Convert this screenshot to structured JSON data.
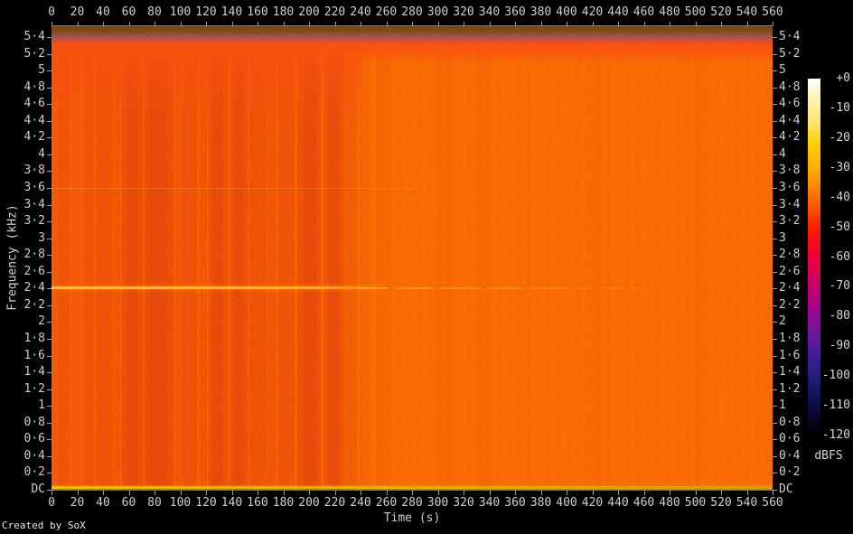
{
  "meta": {
    "credit": "Created by SoX"
  },
  "chart_data": {
    "type": "heatmap",
    "subtype": "audio-spectrogram",
    "title": "",
    "xlabel": "Time (s)",
    "ylabel": "Frequency (kHz)",
    "x_range": [
      0,
      560
    ],
    "x_ticks": [
      0,
      20,
      40,
      60,
      80,
      100,
      120,
      140,
      160,
      180,
      200,
      220,
      240,
      260,
      280,
      300,
      320,
      340,
      360,
      380,
      400,
      420,
      440,
      460,
      480,
      500,
      520,
      540,
      560
    ],
    "y_range_khz": [
      0,
      5.53
    ],
    "y_ticks": [
      {
        "v": 0,
        "l": "DC"
      },
      {
        "v": 0.2,
        "l": "0·2"
      },
      {
        "v": 0.4,
        "l": "0·4"
      },
      {
        "v": 0.6,
        "l": "0·6"
      },
      {
        "v": 0.8,
        "l": "0·8"
      },
      {
        "v": 1,
        "l": "1"
      },
      {
        "v": 1.2,
        "l": "1·2"
      },
      {
        "v": 1.4,
        "l": "1·4"
      },
      {
        "v": 1.6,
        "l": "1·6"
      },
      {
        "v": 1.8,
        "l": "1·8"
      },
      {
        "v": 2,
        "l": "2"
      },
      {
        "v": 2.2,
        "l": "2·2"
      },
      {
        "v": 2.4,
        "l": "2·4"
      },
      {
        "v": 2.6,
        "l": "2·6"
      },
      {
        "v": 2.8,
        "l": "2·8"
      },
      {
        "v": 3,
        "l": "3"
      },
      {
        "v": 3.2,
        "l": "3·2"
      },
      {
        "v": 3.4,
        "l": "3·4"
      },
      {
        "v": 3.6,
        "l": "3·6"
      },
      {
        "v": 3.8,
        "l": "3·8"
      },
      {
        "v": 4,
        "l": "4"
      },
      {
        "v": 4.2,
        "l": "4·2"
      },
      {
        "v": 4.4,
        "l": "4·4"
      },
      {
        "v": 4.6,
        "l": "4·6"
      },
      {
        "v": 4.8,
        "l": "4·8"
      },
      {
        "v": 5,
        "l": "5"
      },
      {
        "v": 5.2,
        "l": "5·2"
      },
      {
        "v": 5.4,
        "l": "5·4"
      }
    ],
    "colorbar": {
      "label": "dBFS",
      "ticks": [
        "+0",
        "-10",
        "-20",
        "-30",
        "-40",
        "-50",
        "-60",
        "-70",
        "-80",
        "-90",
        "-100",
        "-110",
        "-120"
      ],
      "range_db": [
        0,
        -120
      ],
      "stops": [
        {
          "c": "#ffffff",
          "p": 0
        },
        {
          "c": "#fff8d2",
          "p": 3
        },
        {
          "c": "#ffef9c",
          "p": 8
        },
        {
          "c": "#ffe35e",
          "p": 13
        },
        {
          "c": "#ffd100",
          "p": 18
        },
        {
          "c": "#ffb300",
          "p": 24
        },
        {
          "c": "#ff8a00",
          "p": 30
        },
        {
          "c": "#ff5500",
          "p": 36
        },
        {
          "c": "#ff1c00",
          "p": 42
        },
        {
          "c": "#f00032",
          "p": 49
        },
        {
          "c": "#d00060",
          "p": 56
        },
        {
          "c": "#a8008a",
          "p": 63
        },
        {
          "c": "#7c129a",
          "p": 69
        },
        {
          "c": "#531b9e",
          "p": 75
        },
        {
          "c": "#312092",
          "p": 80
        },
        {
          "c": "#1c1c70",
          "p": 85
        },
        {
          "c": "#0e0e4a",
          "p": 91
        },
        {
          "c": "#05051f",
          "p": 96
        },
        {
          "c": "#000000",
          "p": 100
        }
      ]
    },
    "palette": {
      "background_body": "#fb4a02",
      "stripe_red": "#d40012",
      "tone_line_yellow": "#ffd728",
      "top_band_dark": "#03021a",
      "dc_line_yellow": "#e8c400"
    },
    "features": {
      "top_attenuated_band_khz": [
        5.3,
        5.53
      ],
      "bright_red_band_khz": [
        5.1,
        5.3
      ],
      "tone_lines_khz": [
        2.4,
        3.6
      ],
      "dc_line": true,
      "dense_activity_until_s": 230,
      "stripes": [
        {
          "t0": 2,
          "t1": 4,
          "a": 0.3
        },
        {
          "t0": 5,
          "t1": 14,
          "a": 0.42
        },
        {
          "t0": 16,
          "t1": 22,
          "a": 0.22
        },
        {
          "t0": 25,
          "t1": 33,
          "a": 0.45
        },
        {
          "t0": 35,
          "t1": 47,
          "a": 0.5
        },
        {
          "t0": 48,
          "t1": 53,
          "a": 0.28
        },
        {
          "t0": 55,
          "t1": 71,
          "a": 0.62
        },
        {
          "t0": 58,
          "t1": 67,
          "a": 0.78
        },
        {
          "t0": 72,
          "t1": 95,
          "a": 0.66
        },
        {
          "t0": 76,
          "t1": 90,
          "a": 0.82
        },
        {
          "t0": 96,
          "t1": 101,
          "a": 0.32
        },
        {
          "t0": 102,
          "t1": 113,
          "a": 0.5
        },
        {
          "t0": 115,
          "t1": 121,
          "a": 0.34
        },
        {
          "t0": 122,
          "t1": 137,
          "a": 0.56
        },
        {
          "t0": 125,
          "t1": 133,
          "a": 0.72
        },
        {
          "t0": 139,
          "t1": 152,
          "a": 0.6
        },
        {
          "t0": 142,
          "t1": 149,
          "a": 0.76
        },
        {
          "t0": 154,
          "t1": 167,
          "a": 0.5
        },
        {
          "t0": 168,
          "t1": 175,
          "a": 0.32
        },
        {
          "t0": 176,
          "t1": 189,
          "a": 0.52
        },
        {
          "t0": 191,
          "t1": 209,
          "a": 0.6
        },
        {
          "t0": 196,
          "t1": 206,
          "a": 0.76
        },
        {
          "t0": 211,
          "t1": 228,
          "a": 0.56
        },
        {
          "t0": 215,
          "t1": 224,
          "a": 0.68
        },
        {
          "t0": 229,
          "t1": 237,
          "a": 0.36
        },
        {
          "t0": 239,
          "t1": 247,
          "a": 0.18
        },
        {
          "t0": 252,
          "t1": 263,
          "a": 0.12
        },
        {
          "t0": 300,
          "t1": 313,
          "a": 0.09
        },
        {
          "t0": 330,
          "t1": 341,
          "a": 0.07
        },
        {
          "t0": 418,
          "t1": 428,
          "a": 0.07
        },
        {
          "t0": 500,
          "t1": 508,
          "a": 0.06
        }
      ],
      "tone_24_dashes": [
        {
          "t0": 238,
          "t1": 262,
          "a": 0.55
        },
        {
          "t0": 268,
          "t1": 296,
          "a": 0.45
        },
        {
          "t0": 300,
          "t1": 334,
          "a": 0.4
        },
        {
          "t0": 338,
          "t1": 366,
          "a": 0.35
        },
        {
          "t0": 372,
          "t1": 402,
          "a": 0.28
        },
        {
          "t0": 406,
          "t1": 420,
          "a": 0.22
        },
        {
          "t0": 428,
          "t1": 444,
          "a": 0.16
        },
        {
          "t0": 448,
          "t1": 462,
          "a": 0.12
        }
      ]
    }
  }
}
